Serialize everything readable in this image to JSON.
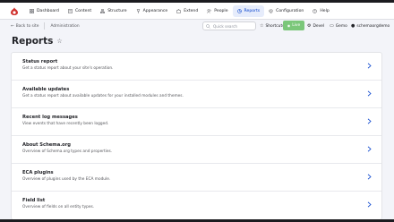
{
  "colors": {
    "accent": "#003ecc",
    "active_bg": "#e6ecfb",
    "live_green": "#7bc77a",
    "page_bg": "#f3f4f9"
  },
  "toolbar": {
    "items": [
      {
        "label": "Dashboard",
        "icon": "dashboard-icon"
      },
      {
        "label": "Content",
        "icon": "content-icon"
      },
      {
        "label": "Structure",
        "icon": "structure-icon"
      },
      {
        "label": "Appearance",
        "icon": "appearance-icon"
      },
      {
        "label": "Extend",
        "icon": "extend-icon"
      },
      {
        "label": "People",
        "icon": "people-icon"
      },
      {
        "label": "Reports",
        "icon": "reports-icon",
        "active": true
      },
      {
        "label": "Configuration",
        "icon": "gear-icon"
      },
      {
        "label": "Help",
        "icon": "help-icon"
      }
    ]
  },
  "subbar": {
    "back_label": "Back to site",
    "admin_label": "Administration",
    "search_placeholder": "Quick search",
    "shortcuts_label": "Shortcuts",
    "live_label": "Live",
    "devel_label": "Devel",
    "gemo_label": "Gemo",
    "user_label": "schemaorgdemo"
  },
  "page": {
    "title": "Reports"
  },
  "reports": [
    {
      "title": "Status report",
      "description": "Get a status report about your site's operation."
    },
    {
      "title": "Available updates",
      "description": "Get a status report about available updates for your installed modules and themes."
    },
    {
      "title": "Recent log messages",
      "description": "View events that have recently been logged."
    },
    {
      "title": "About Schema.org",
      "description": "Overview of Schema.org types and properties."
    },
    {
      "title": "ECA plugins",
      "description": "Overview of plugins used by the ECA module."
    },
    {
      "title": "Field list",
      "description": "Overview of fields on all entity types."
    }
  ]
}
